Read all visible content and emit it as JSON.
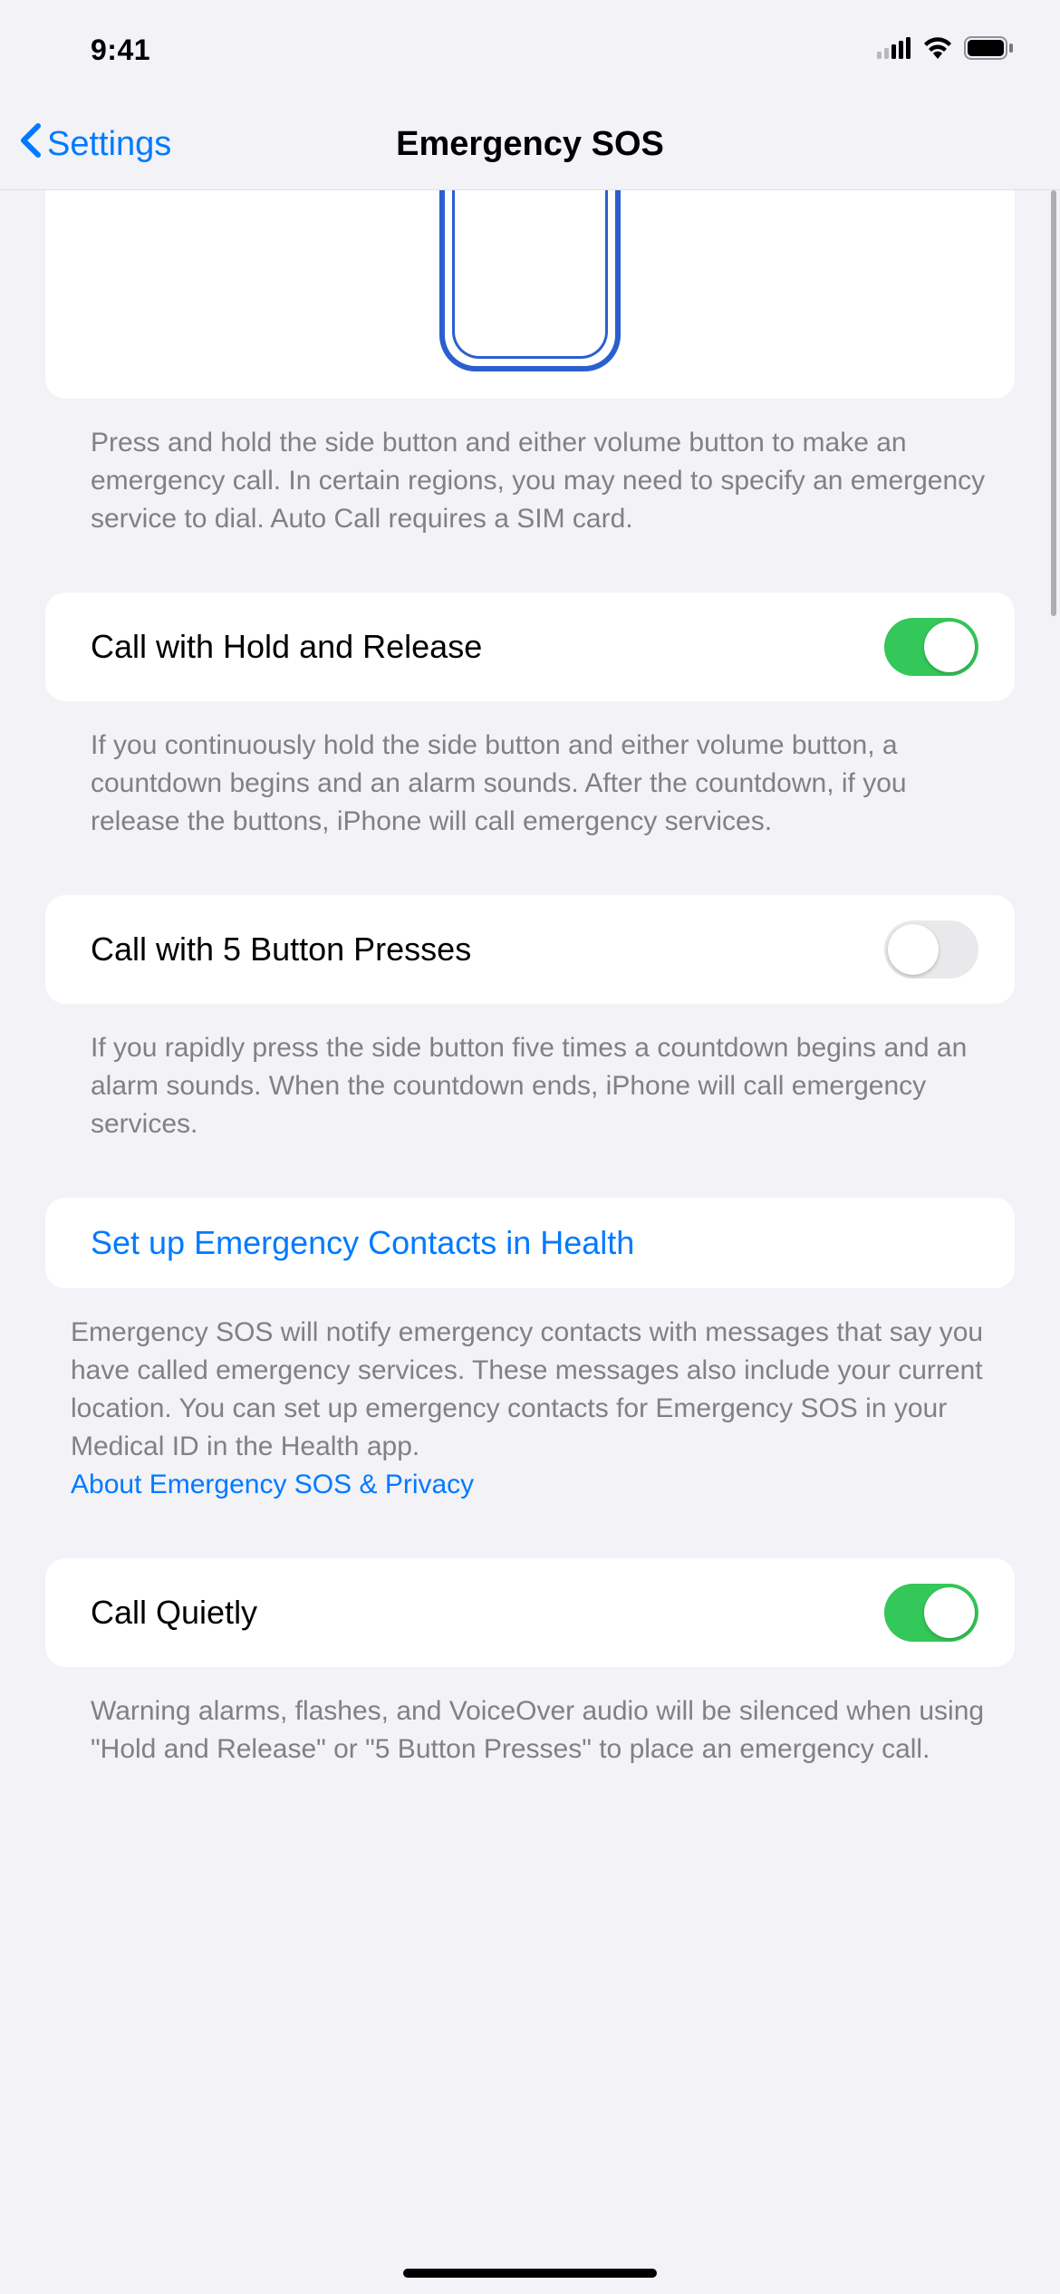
{
  "status": {
    "time": "9:41"
  },
  "nav": {
    "back_label": "Settings",
    "title": "Emergency SOS"
  },
  "hero": {
    "footer": "Press and hold the side button and either volume button to make an emergency call. In certain regions, you may need to specify an emergency service to dial. Auto Call requires a SIM card."
  },
  "options": [
    {
      "label": "Call with Hold and Release",
      "enabled": true,
      "footer": "If you continuously hold the side button and either volume button, a countdown begins and an alarm sounds. After the countdown, if you release the buttons, iPhone will call emergency services."
    },
    {
      "label": "Call with 5 Button Presses",
      "enabled": false,
      "footer": "If you rapidly press the side button five times a countdown begins and an alarm sounds. When the countdown ends, iPhone will call emergency services."
    }
  ],
  "contacts": {
    "link_label": "Set up Emergency Contacts in Health",
    "footer": "Emergency SOS will notify emergency contacts with messages that say you have called emergency services. These messages also include your current location. You can set up emergency contacts for Emergency SOS in your Medical ID in the Health app.",
    "privacy_link": "About Emergency SOS & Privacy"
  },
  "quiet": {
    "label": "Call Quietly",
    "enabled": true,
    "footer": "Warning alarms, flashes, and VoiceOver audio will be silenced when using \"Hold and Release\" or \"5 Button Presses\" to place an emergency call."
  }
}
